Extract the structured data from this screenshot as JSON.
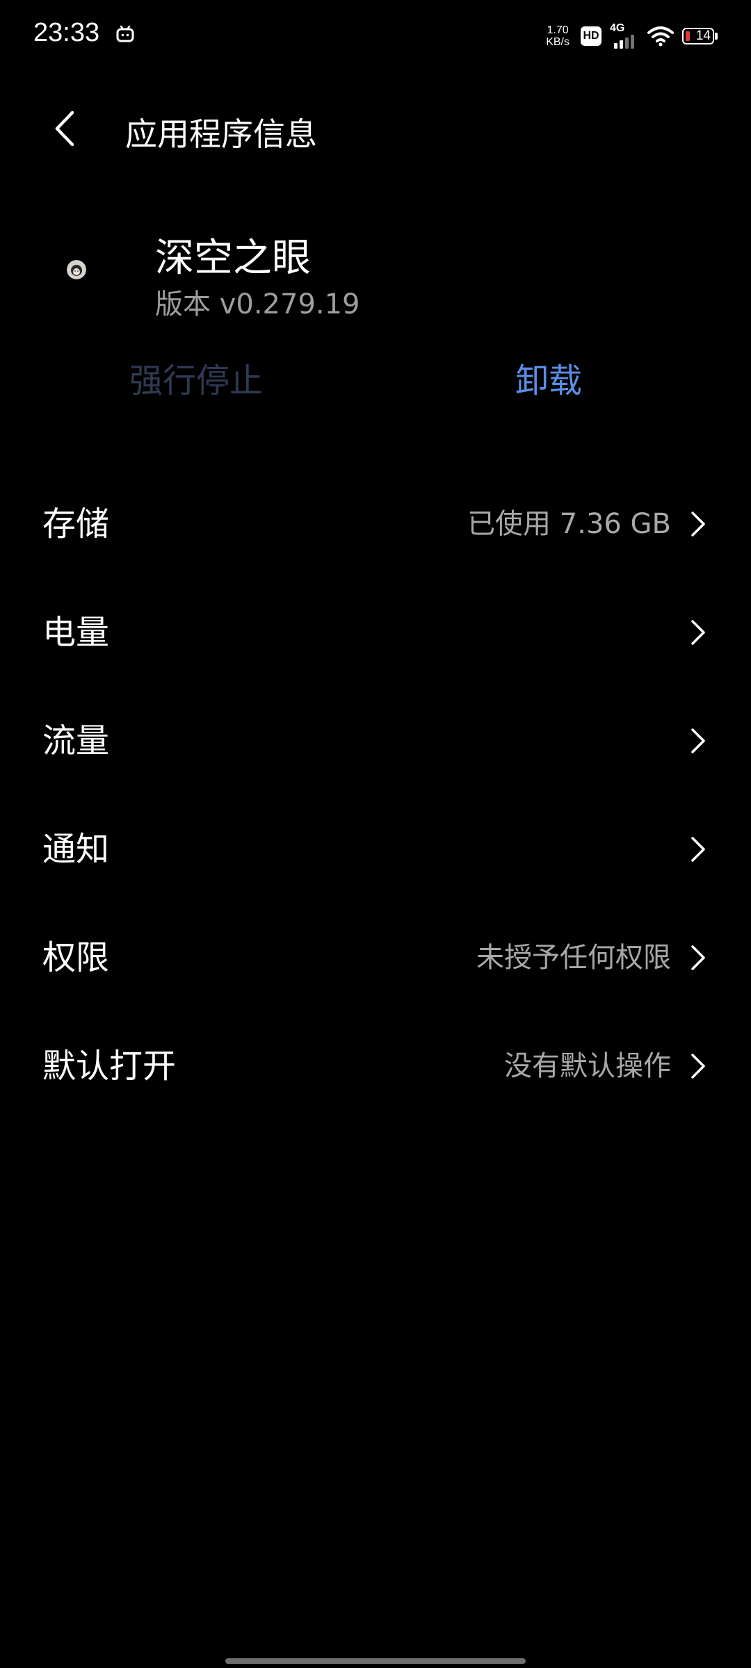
{
  "status_bar": {
    "time": "23:33",
    "net_speed_value": "1.70",
    "net_speed_unit": "KB/s",
    "hd_label": "HD",
    "network_type": "4G",
    "battery_level": "14",
    "battery_color": "#e53935",
    "app_notification_icon": "tv-icon"
  },
  "header": {
    "title": "应用程序信息",
    "back_icon": "chevron-left-icon"
  },
  "app": {
    "name": "深空之眼",
    "version": "版本 v0.279.19"
  },
  "actions": {
    "force_stop": "强行停止",
    "force_stop_enabled": false,
    "uninstall": "卸载",
    "accent_color": "#5b8ee6"
  },
  "settings": [
    {
      "label": "存储",
      "value": "已使用 7.36 GB"
    },
    {
      "label": "电量",
      "value": ""
    },
    {
      "label": "流量",
      "value": ""
    },
    {
      "label": "通知",
      "value": ""
    },
    {
      "label": "权限",
      "value": "未授予任何权限"
    },
    {
      "label": "默认打开",
      "value": "没有默认操作"
    }
  ]
}
